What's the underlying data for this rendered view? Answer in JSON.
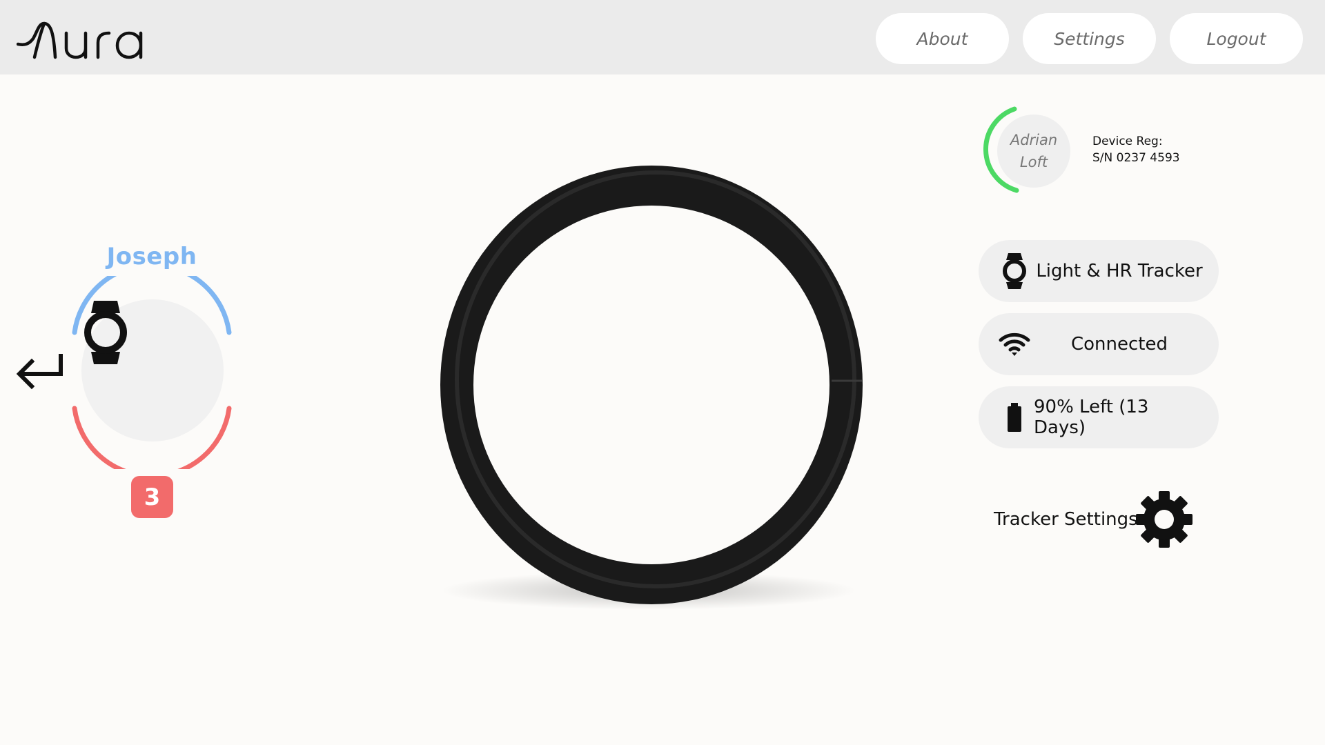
{
  "app": {
    "logo_text": "Aura"
  },
  "nav": {
    "about": "About",
    "settings": "Settings",
    "logout": "Logout"
  },
  "user": {
    "name": "Joseph",
    "notification_count": "3"
  },
  "profile": {
    "first_name": "Adrian",
    "last_name": "Loft"
  },
  "device": {
    "reg_label": "Device Reg:",
    "serial": "S/N 0237 4593"
  },
  "status": {
    "tracker": "Light & HR Tracker",
    "connection": "Connected",
    "battery": "90% Left (13 Days)"
  },
  "tracker_settings": {
    "label": "Tracker Settings"
  },
  "colors": {
    "user_accent": "#7fb6f2",
    "alert": "#f26b6b",
    "profile_ring": "#4cd964"
  },
  "icons": {
    "back": "return-arrow-icon",
    "device": "smartwatch-icon",
    "wifi": "wifi-icon",
    "battery": "battery-icon",
    "gear": "gear-icon"
  }
}
